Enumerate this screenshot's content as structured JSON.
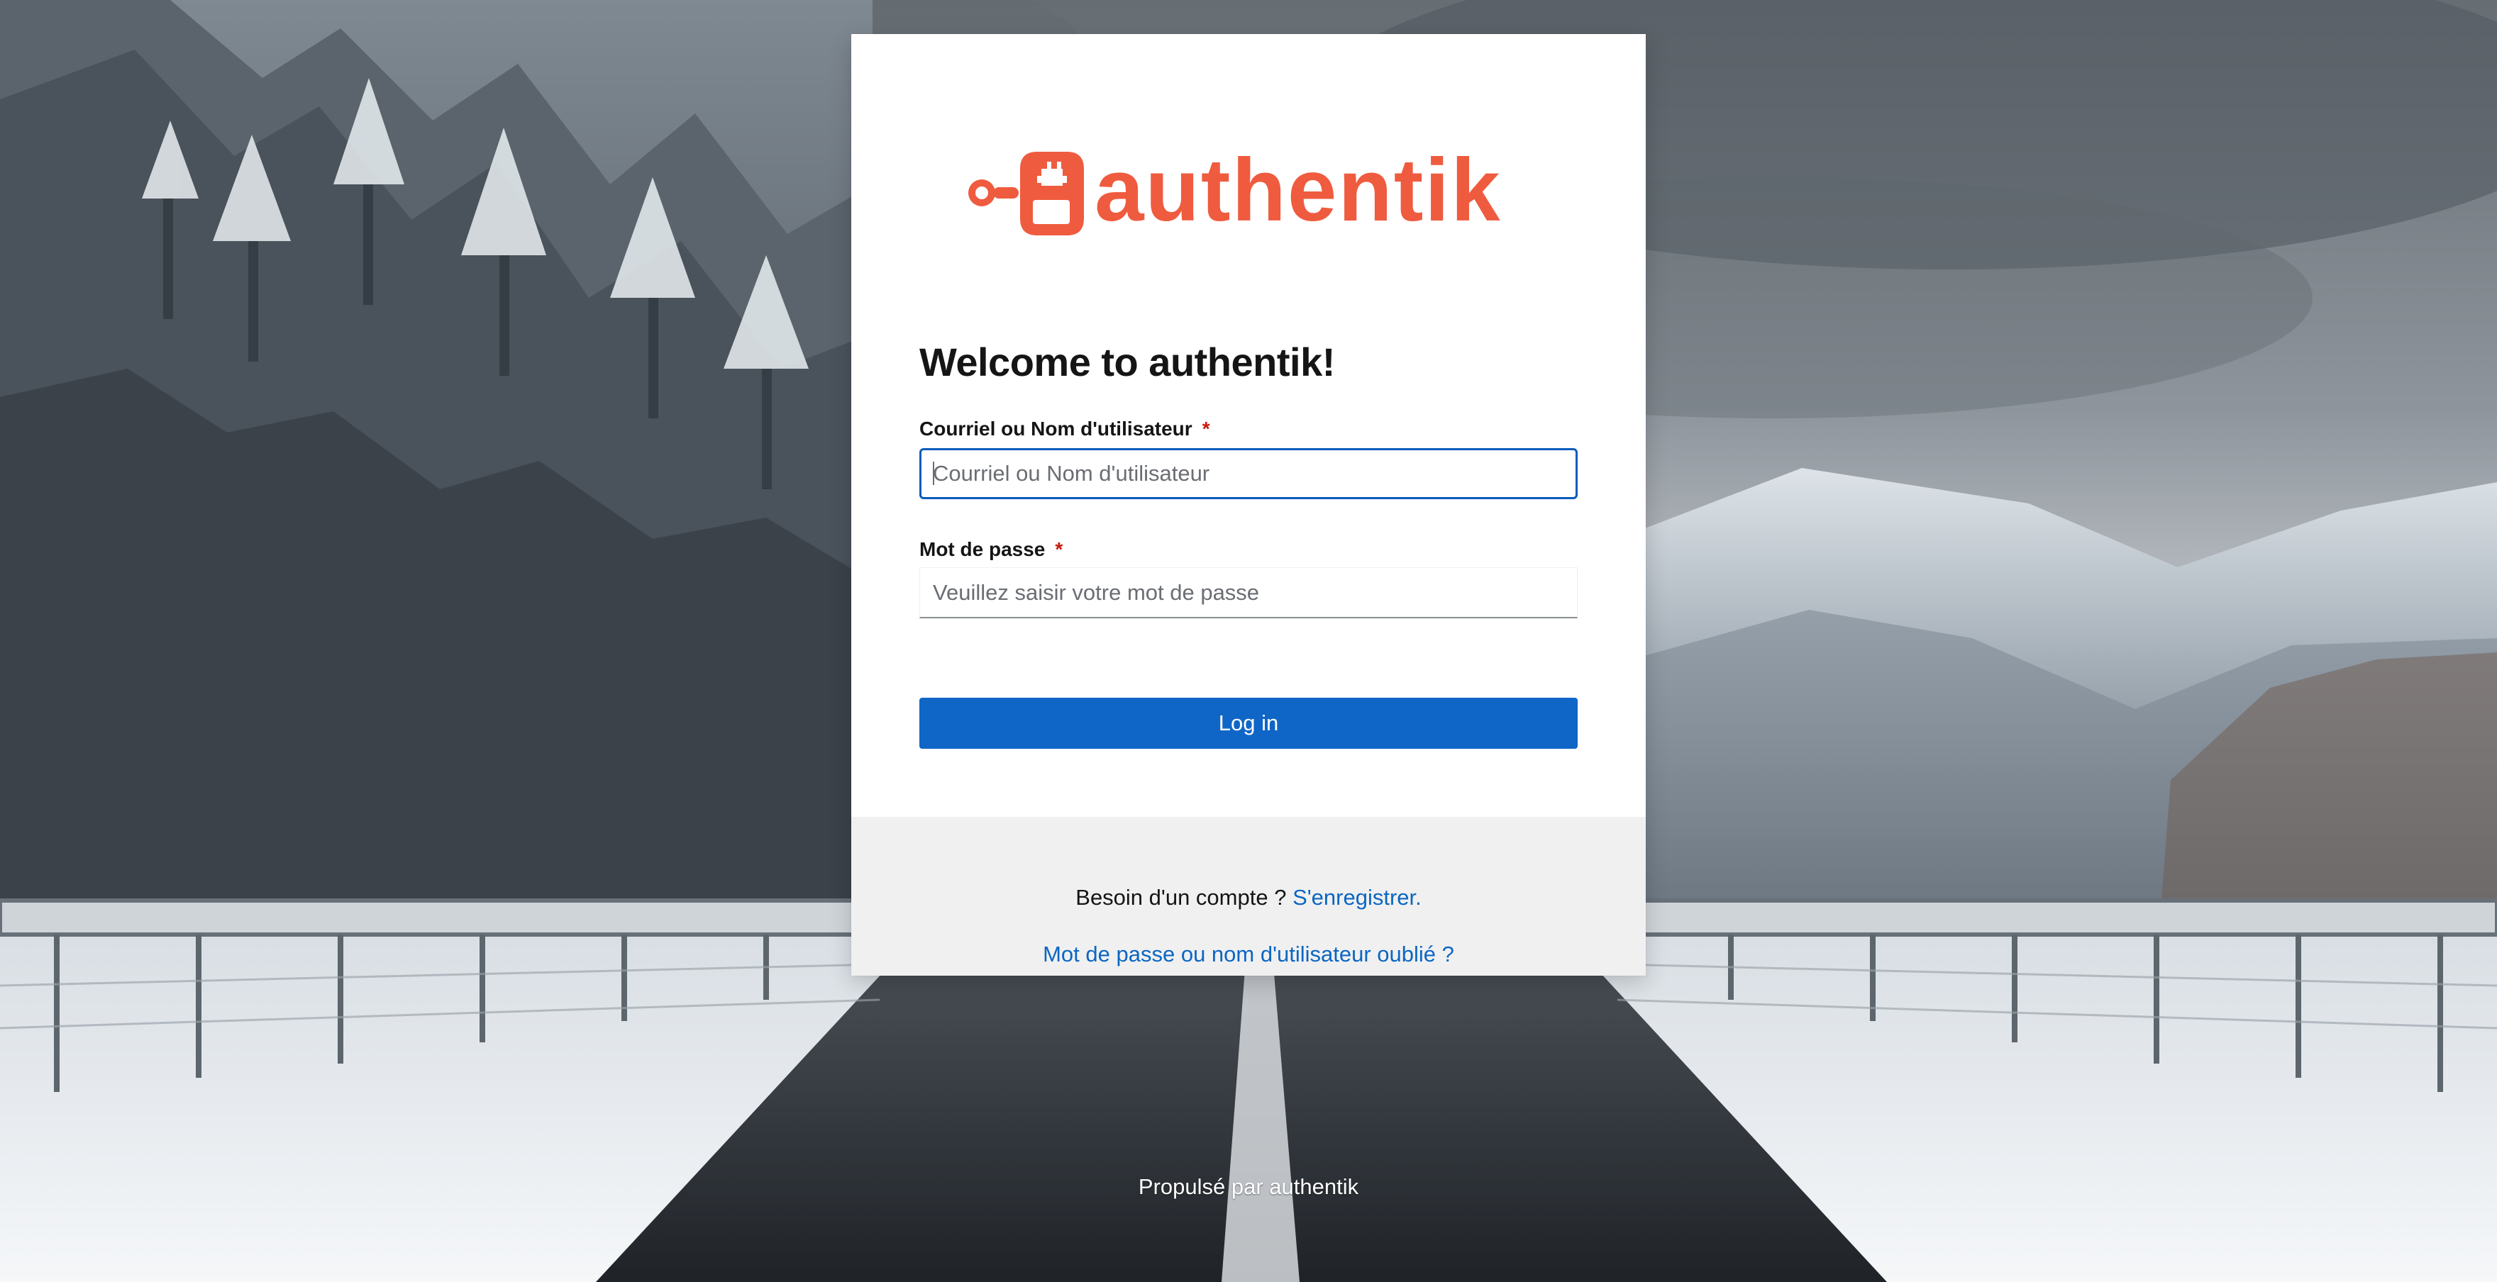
{
  "brand": {
    "name": "authentik",
    "accent_color": "#ef5b3f"
  },
  "login": {
    "heading": "Welcome to authentik!",
    "username_label": "Courriel ou Nom d'utilisateur",
    "username_required_marker": "*",
    "username_placeholder": "Courriel ou Nom d'utilisateur",
    "username_value": "",
    "password_label": "Mot de passe",
    "password_required_marker": "*",
    "password_placeholder": "Veuillez saisir votre mot de passe",
    "password_value": "",
    "submit_label": "Log in"
  },
  "footer": {
    "signup_prompt": "Besoin d'un compte ?",
    "signup_link": "S'enregistrer.",
    "recovery_link": "Mot de passe ou nom d'utilisateur oublié ?"
  },
  "page": {
    "powered_by": "Propulsé par authentik"
  },
  "icons": {
    "logo": "authentik-logo-icon"
  }
}
